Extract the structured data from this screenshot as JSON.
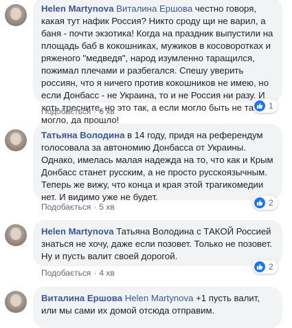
{
  "comments": [
    {
      "author": "Helen Martynova",
      "mention": "Виталина Ершова",
      "text": "честно говоря, какая тут нафик Россия? Никто сроду щи не варил, а баня - почти экзотика! Когда на праздник выпустили на площадь баб в кокошниках, мужиков в косоворотках и ряженого \"медведя\", народ изумленно таращился, пожимал плечами и разбегался. Спешу уверить россиян, что я ничего против кокошников не имею, но если Донбасс - не Украина, то и не Россия ни разу. И хоть тресните, но это так, а если могло быть не так - могло, да прошло!",
      "like_label": "Подобається",
      "time": "6 хв",
      "reaction_count": "1"
    },
    {
      "author": "Татьяна Володина",
      "mention": "",
      "text": "в 14 году, придя на референдум голосовала за автономию Донбасса от Украины. Однако, имелась малая надежда на то, что как и Крым Донбасс станет русским, а не просто русскоязычным. Теперь же вижу, что конца и края этой трагикомедии нет. И видимо уже не будет.",
      "like_label": "Подобається",
      "time": "5 хв",
      "reaction_count": "2"
    },
    {
      "author": "Helen Martynova",
      "mention": "",
      "text": "Татьяна Володина с ТАКОЙ Россией знаться не хочу, даже если позовет. Только не позовет. Ну и пусть валит своей дорогой.",
      "like_label": "Подобається",
      "time": "4 хв",
      "reaction_count": "2"
    },
    {
      "author": "Виталина Ершова",
      "mention": "Helen Martynova",
      "text": "+1 пусть валит, или мы сами их домой отсюда отправим.",
      "like_label": "",
      "time": "",
      "reaction_count": ""
    }
  ],
  "icons": {
    "reaction": "like-icon",
    "avatar": "user-avatar"
  },
  "colors": {
    "author": "#385898",
    "bubble": "#f2f3f5",
    "like": "#1877f2",
    "meta": "#606770"
  }
}
